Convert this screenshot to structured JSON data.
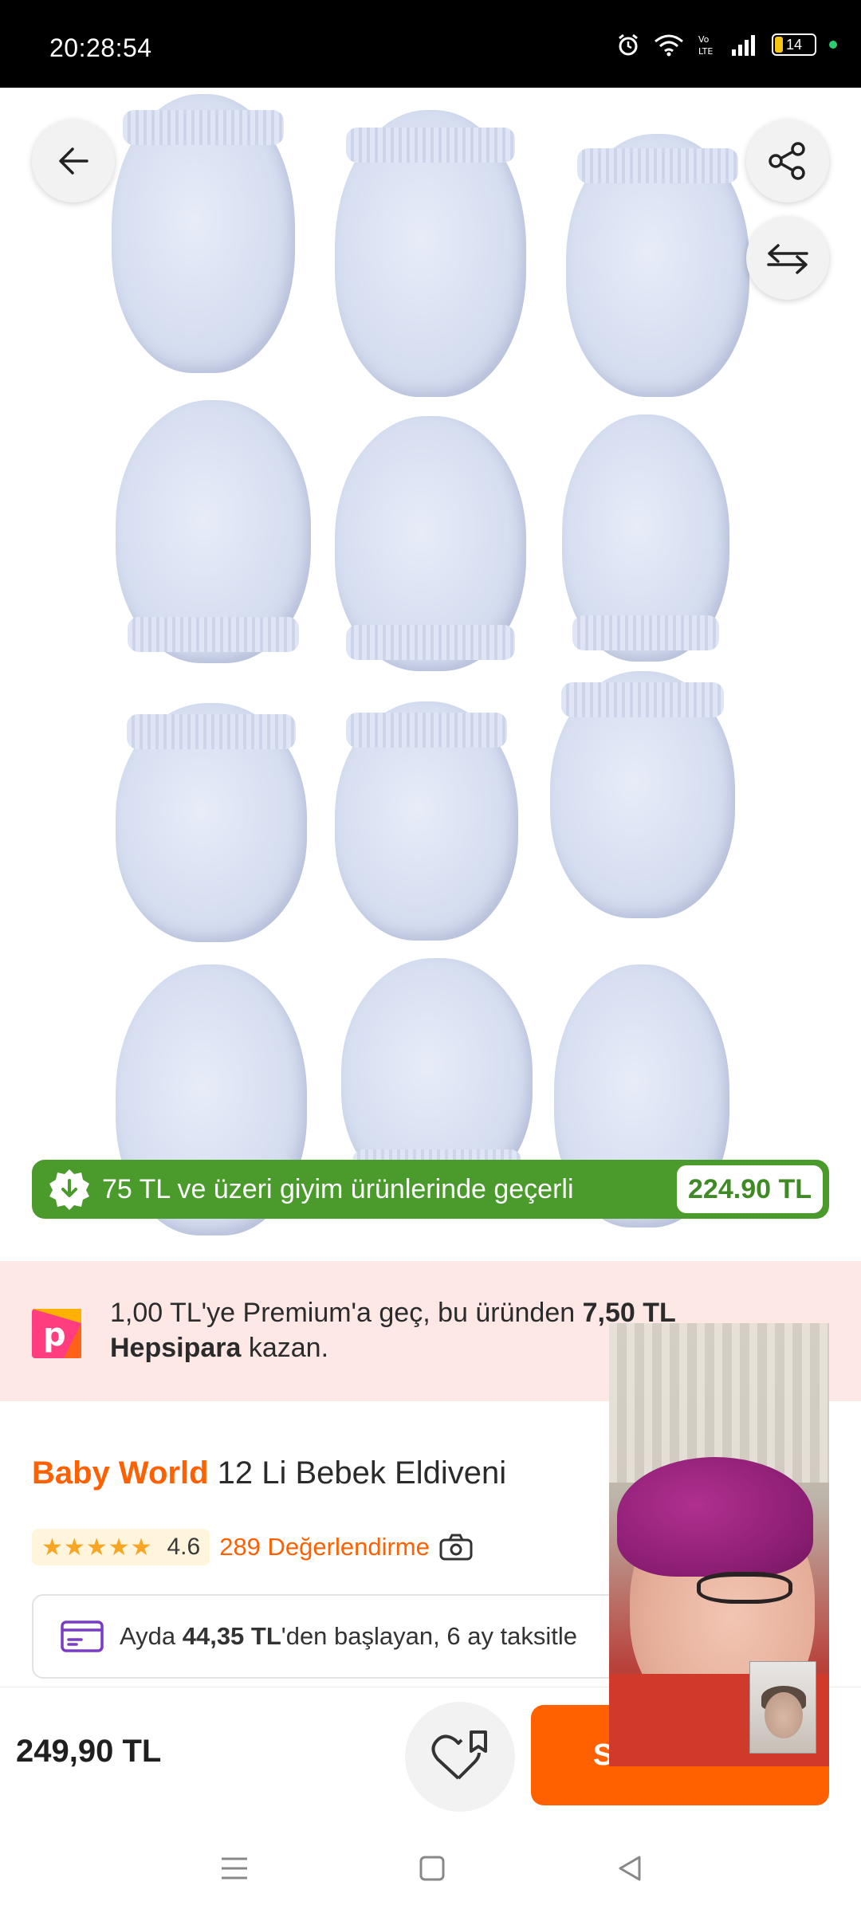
{
  "status_bar": {
    "time": "20:28:54",
    "battery": "14"
  },
  "green_banner": {
    "text": "75 TL ve üzeri giyim ürünlerinde geçerli",
    "price": "224.90 TL"
  },
  "premium": {
    "line1_prefix": "1,00 TL'ye Premium'a geç, bu üründen ",
    "line1_amount": "7,50 TL",
    "line2_brand": "Hepsipara",
    "line2_suffix": " kazan."
  },
  "product": {
    "brand": "Baby World",
    "name": " 12 Li Bebek Eldiveni",
    "rating": "4.6",
    "reviews": "289 Değerlendirme"
  },
  "installment": {
    "prefix": "Ayda ",
    "amount": "44,35 TL",
    "suffix": "'den başlayan, 6 ay taksitle"
  },
  "bottom_bar": {
    "price": "249,90 TL",
    "cart_label": "S"
  },
  "colors": {
    "brand_orange": "#ff6000",
    "promo_green": "#4a9a2c",
    "premium_bg": "#fde8e6",
    "star": "#f6a623"
  },
  "icons": {
    "back": "arrow-left-icon",
    "share": "share-icon",
    "compare": "compare-arrows-icon",
    "badge": "discount-badge-icon",
    "hepsipara": "hepsipara-logo",
    "camera": "camera-icon",
    "card": "credit-card-icon",
    "favorite": "heart-bookmark-icon"
  }
}
